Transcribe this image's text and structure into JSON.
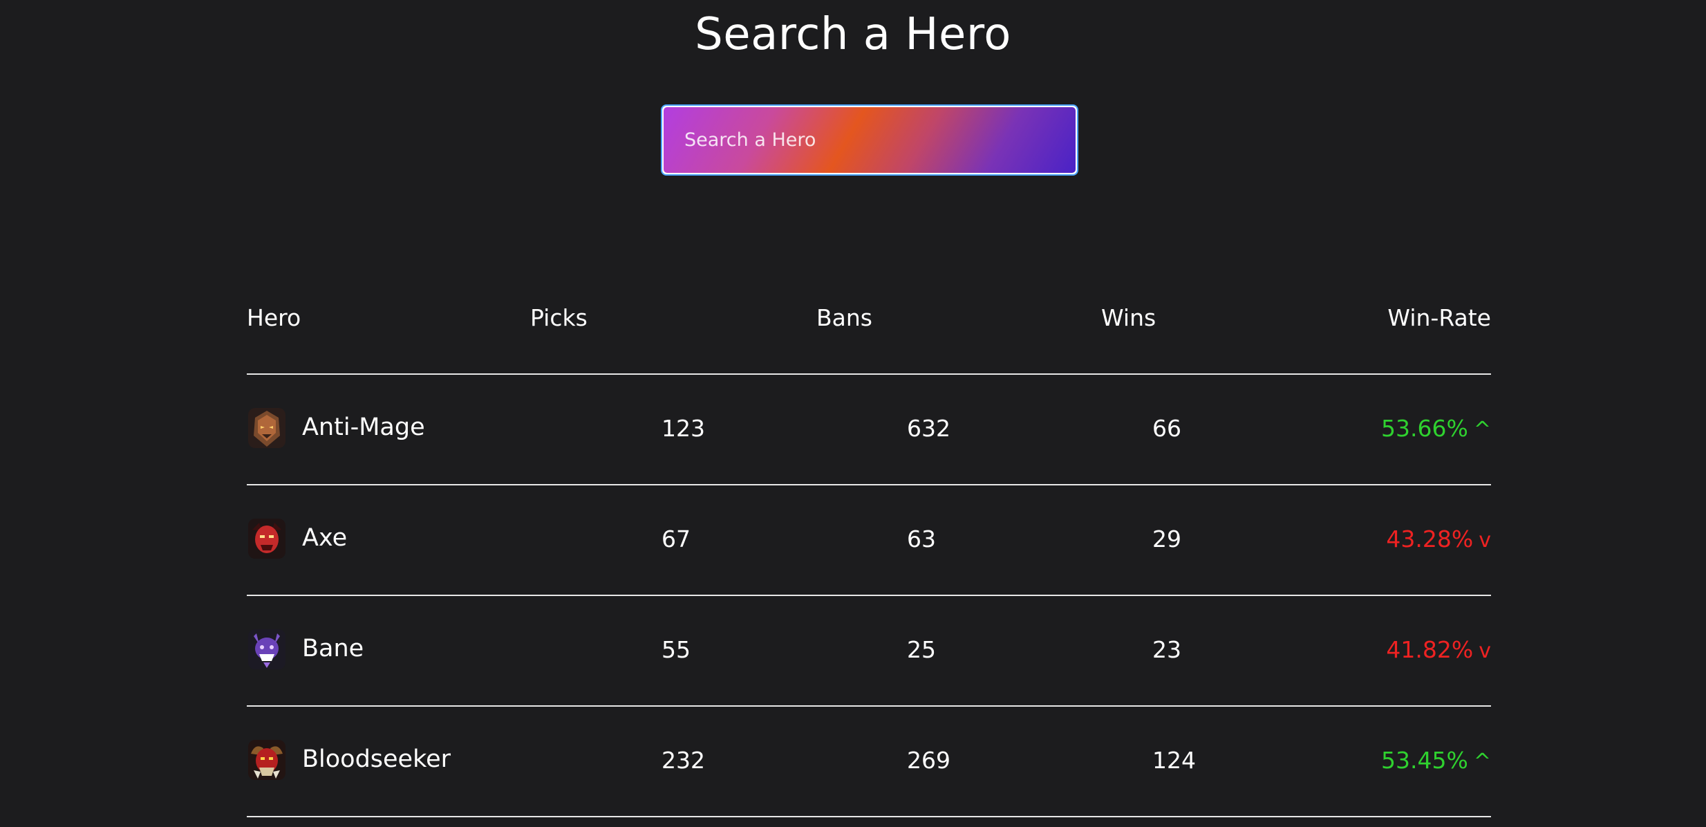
{
  "page": {
    "title": "Search a Hero"
  },
  "search": {
    "placeholder": "Search a Hero",
    "value": ""
  },
  "table": {
    "headers": {
      "hero": "Hero",
      "picks": "Picks",
      "bans": "Bans",
      "wins": "Wins",
      "win_rate": "Win-Rate"
    },
    "rows": [
      {
        "hero": "Anti-Mage",
        "icon": "anti-mage-portrait-icon",
        "picks": "123",
        "bans": "632",
        "wins": "66",
        "win_rate": "53.66%",
        "trend": "^",
        "trend_dir": "up"
      },
      {
        "hero": "Axe",
        "icon": "axe-portrait-icon",
        "picks": "67",
        "bans": "63",
        "wins": "29",
        "win_rate": "43.28%",
        "trend": "v",
        "trend_dir": "down"
      },
      {
        "hero": "Bane",
        "icon": "bane-portrait-icon",
        "picks": "55",
        "bans": "25",
        "wins": "23",
        "win_rate": "41.82%",
        "trend": "v",
        "trend_dir": "down"
      },
      {
        "hero": "Bloodseeker",
        "icon": "bloodseeker-portrait-icon",
        "picks": "232",
        "bans": "269",
        "wins": "124",
        "win_rate": "53.45%",
        "trend": "^",
        "trend_dir": "up"
      }
    ]
  },
  "colors": {
    "background": "#1c1c1e",
    "win_rate_up": "#2fd12f",
    "win_rate_down": "#ee2222",
    "search_border": "#4aa3ff"
  }
}
